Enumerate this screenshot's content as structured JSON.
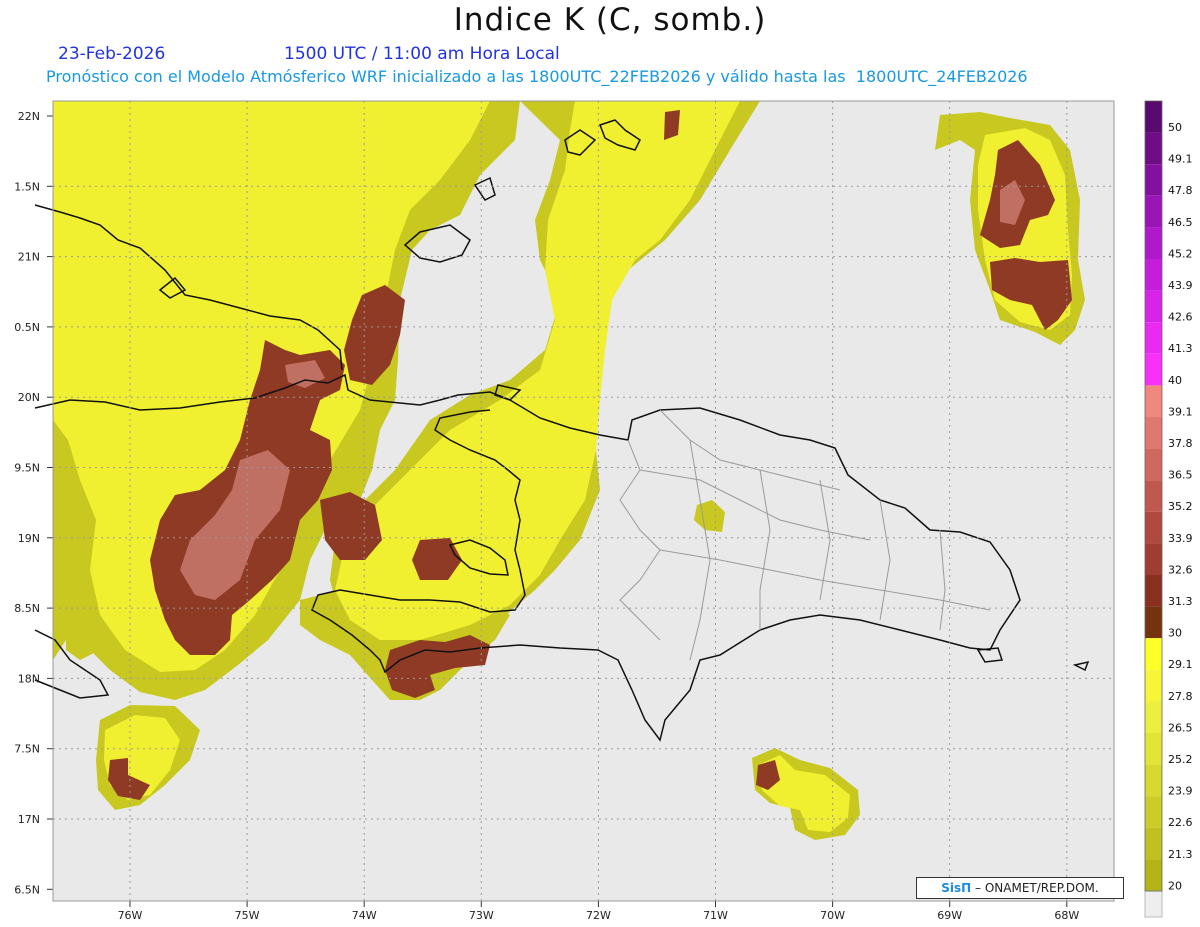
{
  "title": "Indice K (C, somb.)",
  "date": "23-Feb-2026",
  "valid_time": "1500 UTC / 11:00 am Hora Local",
  "forecast_text": "Pronóstico con el Modelo Atmósferico WRF inicializado a las 1800UTC_22FEB2026 y válido hasta las  1800UTC_24FEB2026",
  "lat_labels": [
    "22N",
    "1.5N",
    "21N",
    "0.5N",
    "20N",
    "9.5N",
    "19N",
    "8.5N",
    "18N",
    "7.5N",
    "17N",
    "6.5N"
  ],
  "lon_labels": [
    "76W",
    "75W",
    "74W",
    "73W",
    "72W",
    "71W",
    "70W",
    "69W",
    "68W"
  ],
  "colorbar": {
    "labels": [
      "50",
      "49.1",
      "47.8",
      "46.5",
      "45.2",
      "43.9",
      "42.6",
      "41.3",
      "40",
      "39.1",
      "37.8",
      "36.5",
      "35.2",
      "33.9",
      "32.6",
      "31.3",
      "30",
      "29.1",
      "27.8",
      "26.5",
      "25.2",
      "23.9",
      "22.6",
      "21.3",
      "20"
    ],
    "colors": [
      "#5a0a6e",
      "#6f0d86",
      "#8410a0",
      "#9a14b8",
      "#b018cc",
      "#c41edc",
      "#d824e8",
      "#ea2af2",
      "#f830fa",
      "#f08880",
      "#e07870",
      "#d06860",
      "#c05850",
      "#b04a40",
      "#a03c32",
      "#8a3020",
      "#74320e",
      "#ffff28",
      "#f8f438",
      "#eeee40",
      "#e4e438",
      "#d8d830",
      "#cccc28",
      "#c0c020",
      "#b4b418"
    ]
  },
  "field_colors": {
    "ocean": "#e9e9e9",
    "k_20_25": "#c8c820",
    "k_25_30": "#f0f030",
    "k_30_35": "#8e3a24",
    "k_35_40": "#c07062"
  },
  "credit": {
    "brand": "SisΠ",
    "org": " – ONAMET/REP.DOM."
  }
}
